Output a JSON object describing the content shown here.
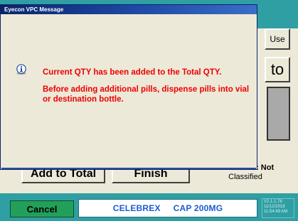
{
  "dialog": {
    "title": "Eyecon VPC Message",
    "message_line1": "Current QTY has been added to the Total QTY.",
    "message_line2": "Before adding additional pills, dispense pills into vial or destination bottle."
  },
  "background": {
    "use_button_label": "Use",
    "to_label": "to",
    "add_to_total_label": "Add to Total",
    "finish_label": "Finish",
    "classification_line1": "DEA Class: Not",
    "classification_line2": "Classified"
  },
  "bottom_bar": {
    "cancel_label": "Cancel",
    "drug_name": "CELEBREX",
    "drug_form": "CAP 200MG",
    "version": "V2.1.1.76",
    "date": "11/12/2018",
    "time": "11:54:49 AM"
  },
  "colors": {
    "teal": "#2f9fa3",
    "dialog_bg": "#ece9d8",
    "message_red": "#ee0000",
    "drug_blue": "#1a5cd1",
    "cancel_green": "#22a05a"
  },
  "icons": {
    "message_icon": "info-icon"
  }
}
